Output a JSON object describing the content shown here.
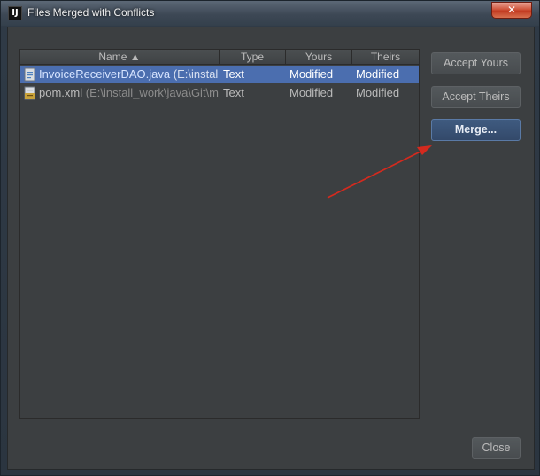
{
  "window": {
    "title": "Files Merged with Conflicts",
    "close_glyph": "✕",
    "app_icon_glyph": "IJ"
  },
  "table": {
    "columns": [
      {
        "label": "Name ▲"
      },
      {
        "label": "Type"
      },
      {
        "label": "Yours"
      },
      {
        "label": "Theirs"
      }
    ],
    "rows": [
      {
        "name": "InvoiceReceiverDAO.java",
        "path": " (E:\\install_",
        "type": "Text",
        "yours": "Modified",
        "theirs": "Modified",
        "icon": "java-file-icon",
        "selected": true
      },
      {
        "name": "pom.xml",
        "path": " (E:\\install_work\\java\\Git\\m",
        "type": "Text",
        "yours": "Modified",
        "theirs": "Modified",
        "icon": "xml-file-icon",
        "selected": false
      }
    ]
  },
  "buttons": {
    "accept_yours": "Accept Yours",
    "accept_theirs": "Accept Theirs",
    "merge": "Merge...",
    "close": "Close"
  },
  "colors": {
    "selection": "#4b6eaf",
    "annotation_arrow": "#d42a1e",
    "primary_button": "#3f5b80"
  }
}
